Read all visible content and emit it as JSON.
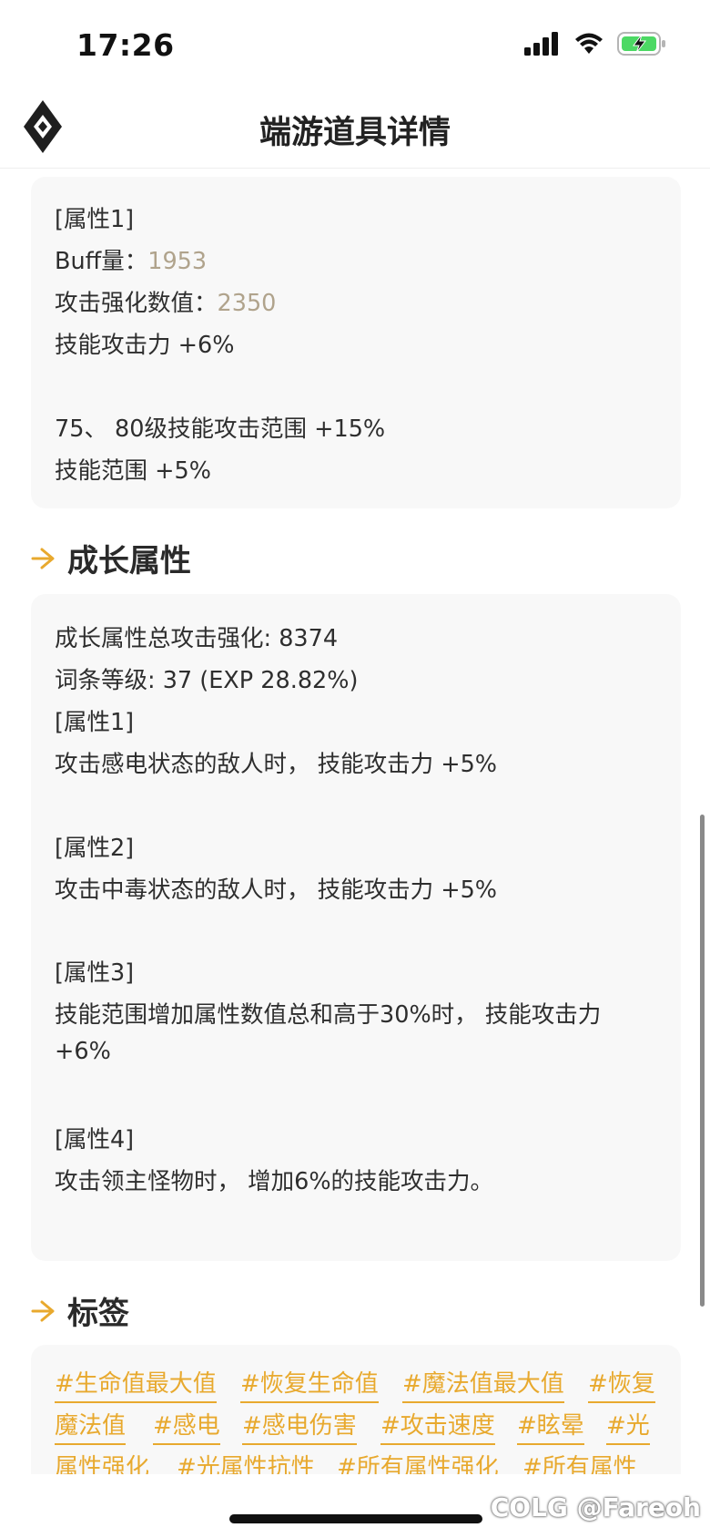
{
  "status_bar": {
    "time": "17:26",
    "icons": [
      "signal-icon",
      "wifi-icon",
      "battery-charging-icon"
    ]
  },
  "header": {
    "logo_icon": "diamond-logo-icon",
    "title": "端游道具详情"
  },
  "attributes_card": {
    "lines": [
      {
        "text": "[属性1]"
      },
      {
        "label": "Buff量：",
        "value": "1953"
      },
      {
        "label": "攻击强化数值：",
        "value": "2350"
      },
      {
        "text": "技能攻击力 +6%"
      },
      {
        "text": ""
      },
      {
        "text": "75、 80级技能攻击范围 +15%"
      },
      {
        "text": "技能范围 +5%"
      }
    ]
  },
  "growth_section": {
    "heading": "成长属性",
    "lines": [
      "成长属性总攻击强化: 8374",
      "词条等级: 37 (EXP 28.82%)",
      "[属性1]",
      "攻击感电状态的敌人时， 技能攻击力 +5%",
      "",
      "[属性2]",
      "攻击中毒状态的敌人时， 技能攻击力 +5%",
      "",
      "[属性3]",
      "技能范围增加属性数值总和高于30%时， 技能攻击力",
      "+6%",
      "",
      "[属性4]",
      "攻击领主怪物时， 增加6%的技能攻击力。"
    ]
  },
  "tags_section": {
    "heading": "标签",
    "rows": [
      [
        "#生命值最大值",
        "#恢复生命值",
        "#魔法值最大值",
        "#恢复"
      ],
      [
        "魔法值",
        "#感电",
        "#感电伤害",
        "#攻击速度",
        "#眩晕",
        "#光"
      ],
      [
        "属性强化",
        "#光属性抗性",
        "#所有属性强化",
        "#所有属性"
      ]
    ]
  },
  "watermark": "COLG @Fareoh",
  "colors": {
    "accent": "#e8a92e",
    "value_text": "#b0a38c",
    "card_bg": "#f8f8f8"
  }
}
